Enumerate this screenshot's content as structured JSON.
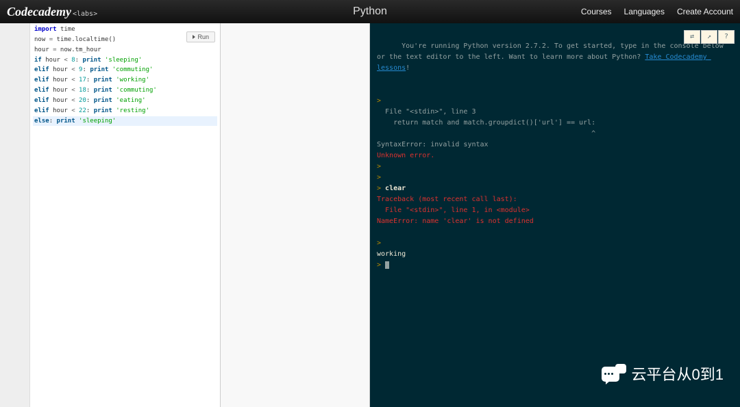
{
  "header": {
    "logo": "Codecademy",
    "logo_suffix": "<labs>",
    "title": "Python",
    "nav": {
      "courses": "Courses",
      "languages": "Languages",
      "create": "Create Account"
    }
  },
  "editor": {
    "run_label": "Run",
    "code": [
      [
        {
          "t": "import ",
          "c": "kw"
        },
        {
          "t": "time"
        }
      ],
      [
        {
          "t": "now "
        },
        {
          "t": "=",
          "c": "op"
        },
        {
          "t": " time.localtime()"
        }
      ],
      [
        {
          "t": "hour "
        },
        {
          "t": "=",
          "c": "op"
        },
        {
          "t": " now.tm_hour"
        }
      ],
      [
        {
          "t": "if",
          "c": "kw2"
        },
        {
          "t": " hour "
        },
        {
          "t": "<",
          "c": "op"
        },
        {
          "t": " "
        },
        {
          "t": "8",
          "c": "num"
        },
        {
          "t": ": "
        },
        {
          "t": "print",
          "c": "kw2"
        },
        {
          "t": " "
        },
        {
          "t": "'sleeping'",
          "c": "str"
        }
      ],
      [
        {
          "t": "elif",
          "c": "kw2"
        },
        {
          "t": " hour "
        },
        {
          "t": "<",
          "c": "op"
        },
        {
          "t": " "
        },
        {
          "t": "9",
          "c": "num"
        },
        {
          "t": ": "
        },
        {
          "t": "print",
          "c": "kw2"
        },
        {
          "t": " "
        },
        {
          "t": "'commuting'",
          "c": "str"
        }
      ],
      [
        {
          "t": "elif",
          "c": "kw2"
        },
        {
          "t": " hour "
        },
        {
          "t": "<",
          "c": "op"
        },
        {
          "t": " "
        },
        {
          "t": "17",
          "c": "num"
        },
        {
          "t": ": "
        },
        {
          "t": "print",
          "c": "kw2"
        },
        {
          "t": " "
        },
        {
          "t": "'working'",
          "c": "str"
        }
      ],
      [
        {
          "t": "elif",
          "c": "kw2"
        },
        {
          "t": " hour "
        },
        {
          "t": "<",
          "c": "op"
        },
        {
          "t": " "
        },
        {
          "t": "18",
          "c": "num"
        },
        {
          "t": ": "
        },
        {
          "t": "print",
          "c": "kw2"
        },
        {
          "t": " "
        },
        {
          "t": "'commuting'",
          "c": "str"
        }
      ],
      [
        {
          "t": "elif",
          "c": "kw2"
        },
        {
          "t": " hour "
        },
        {
          "t": "<",
          "c": "op"
        },
        {
          "t": " "
        },
        {
          "t": "20",
          "c": "num"
        },
        {
          "t": ": "
        },
        {
          "t": "print",
          "c": "kw2"
        },
        {
          "t": " "
        },
        {
          "t": "'eating'",
          "c": "str"
        }
      ],
      [
        {
          "t": "elif",
          "c": "kw2"
        },
        {
          "t": " hour "
        },
        {
          "t": "<",
          "c": "op"
        },
        {
          "t": " "
        },
        {
          "t": "22",
          "c": "num"
        },
        {
          "t": ": "
        },
        {
          "t": "print",
          "c": "kw2"
        },
        {
          "t": " "
        },
        {
          "t": "'resting'",
          "c": "str"
        }
      ],
      [
        {
          "t": "else",
          "c": "kw2"
        },
        {
          "t": ": "
        },
        {
          "t": "print",
          "c": "kw2"
        },
        {
          "t": " "
        },
        {
          "t": "'sleeping'",
          "c": "str"
        }
      ]
    ],
    "active_line_index": 9
  },
  "console": {
    "toolbar": {
      "link_unlink": "⇄",
      "share": "↗",
      "help": "?"
    },
    "intro_pre": "You're running Python version 2.7.2. To get started, type in the console below or the text editor to the left. Want to learn more about Python? ",
    "intro_link": "Take Codecademy lessons",
    "intro_post": "!",
    "lines": [
      {
        "spans": []
      },
      {
        "spans": [
          {
            "t": "> ",
            "c": "prompt"
          }
        ]
      },
      {
        "spans": [
          {
            "t": "  File \"<stdin>\", line 3"
          }
        ]
      },
      {
        "spans": [
          {
            "t": "    return match and match.groupdict()['url'] == url:"
          }
        ]
      },
      {
        "spans": [
          {
            "t": "                                                    ^"
          }
        ]
      },
      {
        "spans": [
          {
            "t": "SyntaxError: invalid syntax"
          }
        ]
      },
      {
        "spans": [
          {
            "t": "Unknown error.",
            "c": "err-red"
          }
        ]
      },
      {
        "spans": [
          {
            "t": "> ",
            "c": "prompt"
          }
        ]
      },
      {
        "spans": [
          {
            "t": "> ",
            "c": "prompt"
          }
        ]
      },
      {
        "spans": [
          {
            "t": "> ",
            "c": "prompt"
          },
          {
            "t": "clear",
            "c": "white bold"
          }
        ]
      },
      {
        "spans": [
          {
            "t": "Traceback (most recent call last):",
            "c": "err-red"
          }
        ]
      },
      {
        "spans": [
          {
            "t": "  File \"<stdin>\", line 1, in <module>",
            "c": "err-red"
          }
        ]
      },
      {
        "spans": [
          {
            "t": "NameError: name 'clear' is not defined",
            "c": "err-red"
          }
        ]
      },
      {
        "spans": []
      },
      {
        "spans": [
          {
            "t": "> ",
            "c": "prompt"
          }
        ]
      },
      {
        "spans": [
          {
            "t": "working",
            "c": "white"
          }
        ]
      },
      {
        "spans": [
          {
            "t": "> ",
            "c": "prompt"
          }
        ],
        "cursor": true
      }
    ]
  },
  "overlay": {
    "text": "云平台从0到1"
  }
}
